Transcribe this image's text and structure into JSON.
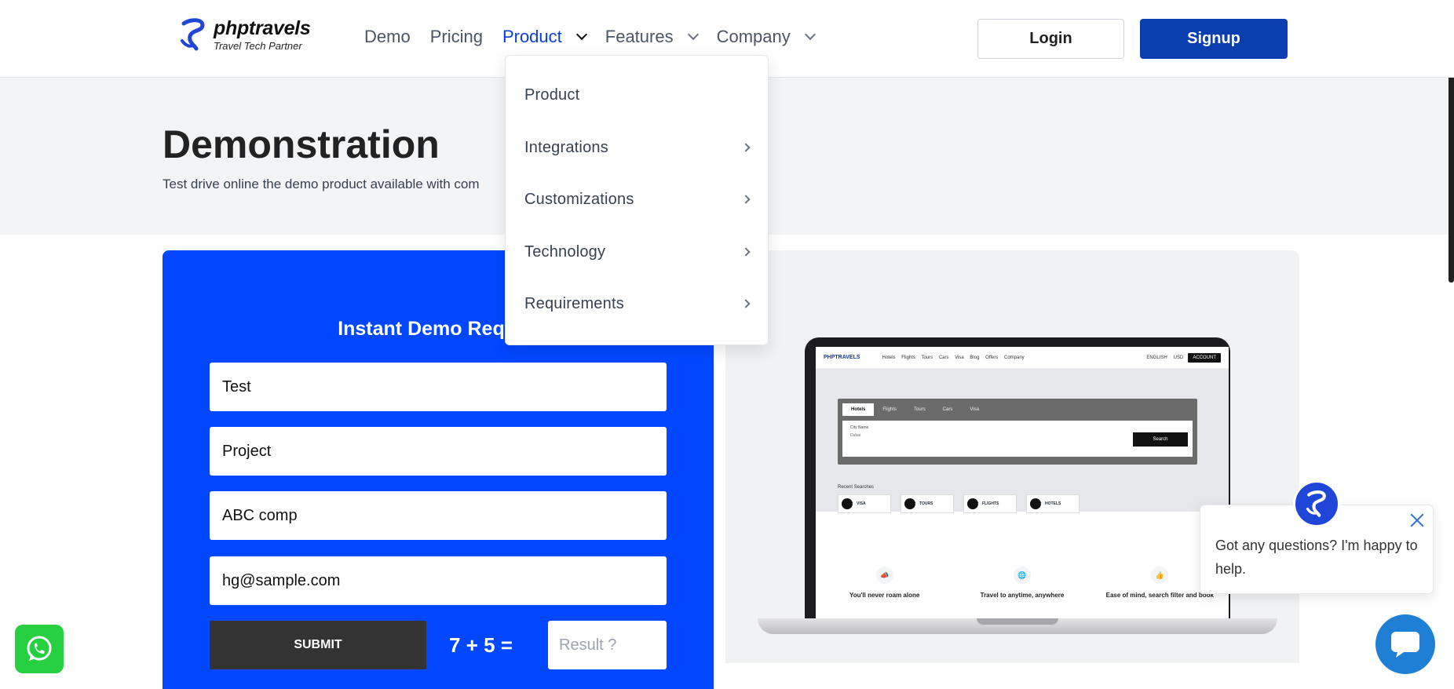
{
  "header": {
    "brand": {
      "name": "phptravels",
      "tagline": "Travel Tech Partner"
    },
    "nav": [
      {
        "label": "Demo",
        "dropdown": false,
        "active": false
      },
      {
        "label": "Pricing",
        "dropdown": false,
        "active": false
      },
      {
        "label": "Product",
        "dropdown": true,
        "active": true
      },
      {
        "label": "Features",
        "dropdown": true,
        "active": false
      },
      {
        "label": "Company",
        "dropdown": true,
        "active": false
      }
    ],
    "login_label": "Login",
    "signup_label": "Signup"
  },
  "product_menu": {
    "items": [
      {
        "label": "Product",
        "submenu": false
      },
      {
        "label": "Integrations",
        "submenu": true
      },
      {
        "label": "Customizations",
        "submenu": true
      },
      {
        "label": "Technology",
        "submenu": true
      },
      {
        "label": "Requirements",
        "submenu": true
      }
    ]
  },
  "hero": {
    "title": "Demonstration",
    "subtitle": "Test drive online the demo product available with com"
  },
  "form": {
    "title": "Instant Demo Reques",
    "fields": [
      {
        "name": "first-name",
        "value": "Test"
      },
      {
        "name": "last-name",
        "value": "Project"
      },
      {
        "name": "business-name",
        "value": "ABC comp"
      },
      {
        "name": "email",
        "value": "hg@sample.com"
      }
    ],
    "submit_label": "SUBMIT",
    "captcha": "7 + 5 =",
    "result_placeholder": "Result ?"
  },
  "preview": {
    "nav_logo": "PHPTRAVELS",
    "nav_links": [
      "Hotels",
      "Flights",
      "Tours",
      "Cars",
      "Visa",
      "Blog",
      "Offers",
      "Company"
    ],
    "lang": "ENGLISH",
    "currency": "USD",
    "account": "ACCOUNT",
    "tabs": [
      "Hotels",
      "Flights",
      "Tours",
      "Cars",
      "Visa"
    ],
    "labels": "City Name",
    "city": "Dubai",
    "search_label": "Search",
    "recent_label": "Recent Searches",
    "cards": [
      "VISA",
      "TOURS",
      "FLIGHTS",
      "HOTELS"
    ],
    "features": [
      "You'll never roam alone",
      "Travel to anytime, anywhere",
      "Ease of mind, search filter and book"
    ]
  },
  "chat": {
    "message": "Got any questions? I'm happy to help."
  },
  "colors": {
    "brand_blue": "#0b3fb0",
    "form_blue": "#0047ff",
    "active_nav": "#0a3fd6",
    "whatsapp": "#26d041",
    "chat_blue": "#1e7fd4"
  }
}
